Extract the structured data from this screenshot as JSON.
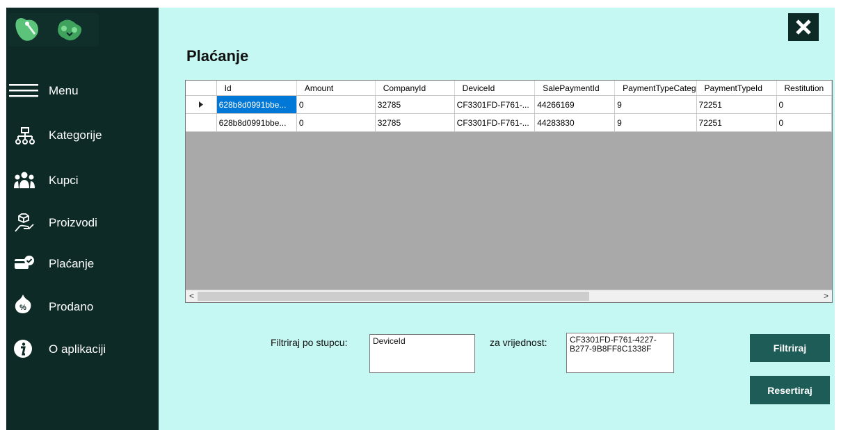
{
  "sidebar": {
    "menu_label": "Menu",
    "items": [
      {
        "label": "Kategorije",
        "icon": "sitemap-icon"
      },
      {
        "label": "Kupci",
        "icon": "users-icon"
      },
      {
        "label": "Proizvodi",
        "icon": "hand-box-icon"
      },
      {
        "label": "Plaćanje",
        "icon": "payment-icon"
      },
      {
        "label": "Prodano",
        "icon": "sale-tag-icon"
      },
      {
        "label": "O aplikaciji",
        "icon": "info-icon"
      }
    ]
  },
  "header": {
    "title": "Plaćanje"
  },
  "grid": {
    "columns": [
      "Id",
      "Amount",
      "CompanyId",
      "DeviceId",
      "SalePaymentId",
      "PaymentTypeCateg",
      "PaymentTypeId",
      "Restitution"
    ],
    "rows": [
      [
        "628b8d0991bbe...",
        "0",
        "32785",
        "CF3301FD-F761-...",
        "44266169",
        "9",
        "72251",
        "0"
      ],
      [
        "628b8d0991bbe...",
        "0",
        "32785",
        "CF3301FD-F761-...",
        "44283830",
        "9",
        "72251",
        "0"
      ]
    ]
  },
  "filter": {
    "column_label": "Filtriraj po stupcu:",
    "column_value": "DeviceId",
    "value_label": "za vrijednost:",
    "value_value": "CF3301FD-F761-4227-B277-9B8FF8C1338F",
    "filter_button": "Filtriraj",
    "reset_button": "Resertiraj"
  },
  "colors": {
    "sidebar_bg": "#0d2a27",
    "main_bg": "#c6f8f3",
    "button_bg": "#1e5d57",
    "selection": "#0078d7"
  }
}
